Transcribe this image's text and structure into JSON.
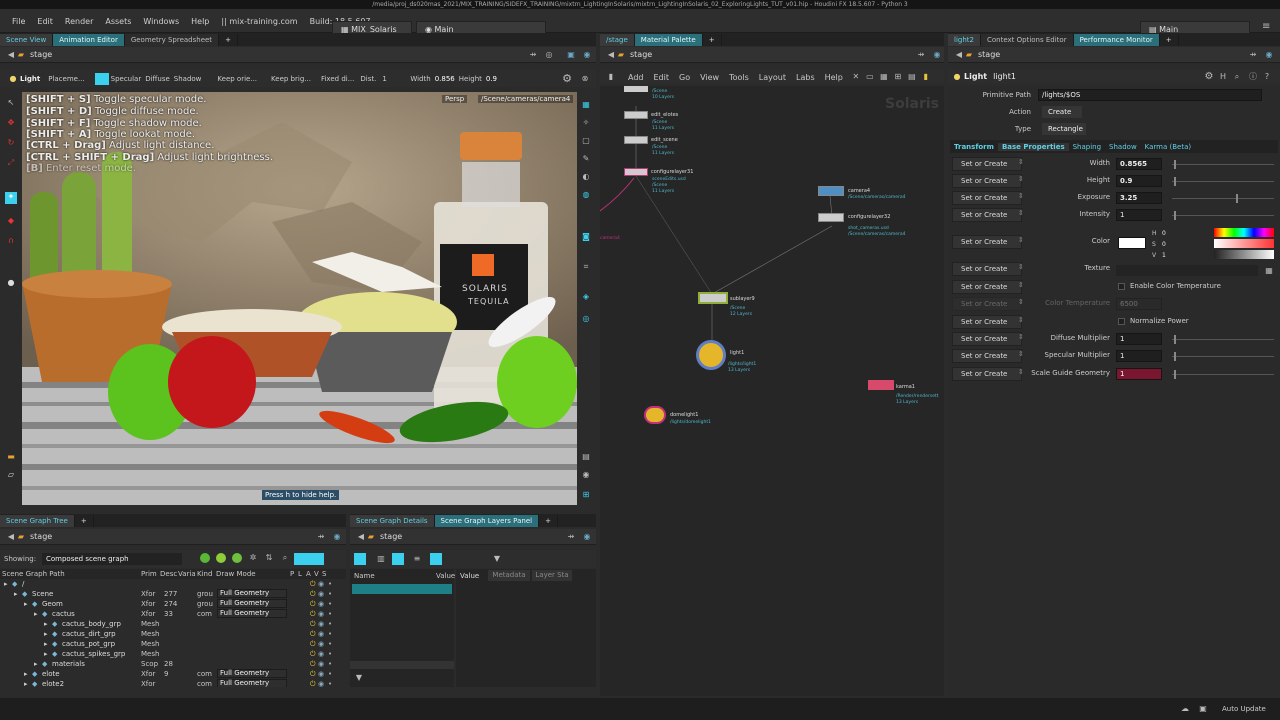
{
  "window": {
    "title": "/media/proj_ds020mas_2021/MIX_TRAINING/SIDEFX_TRAINING/mixtrn_LightingInSolaris/mixtrn_LightingInSolaris_02_ExploringLights_TUT_v01.hip - Houdini FX 18.5.607 - Python 3"
  },
  "menubar": {
    "items": [
      "File",
      "Edit",
      "Render",
      "Assets",
      "Windows",
      "Help"
    ],
    "site": "|| mix-training.com",
    "build": "Build: 18.5.607",
    "desktop1": "MIX_Solaris",
    "desktop2": "Main",
    "desktop3": "Main"
  },
  "left": {
    "tabs": [
      "Scene View",
      "Animation Editor",
      "Geometry Spreadsheet"
    ],
    "path": "stage",
    "toolbar": {
      "light": "Light",
      "placement": "Placeme...",
      "specular": "Specular",
      "diffuse": "Diffuse",
      "shadow": "Shadow",
      "keep_orient": "Keep orie...",
      "keep_bright": "Keep brig...",
      "fixed_dist": "Fixed di...",
      "dist_label": "Dist.",
      "dist_value": "1",
      "width_label": "Width",
      "width_value": "0.856",
      "height_label": "Height",
      "height_value": "0.9"
    },
    "viewport": {
      "persp": "Persp",
      "camera": "/Scene/cameras/camera4",
      "hint": "Press h to hide help.",
      "hud": [
        {
          "key": "[SHIFT + S]",
          "text": " Toggle specular mode."
        },
        {
          "key": "[SHIFT + D]",
          "text": " Toggle diffuse mode."
        },
        {
          "key": "[SHIFT + F]",
          "text": " Toggle shadow mode."
        },
        {
          "key": "[SHIFT + A]",
          "text": " Toggle lookat mode."
        },
        {
          "key": "[CTRL + Drag]",
          "text": " Adjust light distance."
        },
        {
          "key": "[CTRL + SHIFT + Drag]",
          "text": " Adjust light brightness."
        },
        {
          "key": "[B]",
          "text": " Enter reset mode."
        }
      ],
      "bottle_text1": "SOLARIS",
      "bottle_text2": "TEQUILA"
    }
  },
  "middle": {
    "tabs": [
      "/stage",
      "Material Palette"
    ],
    "path": "stage",
    "menu": [
      "Add",
      "Edit",
      "Go",
      "View",
      "Tools",
      "Layout",
      "Labs",
      "Help"
    ],
    "watermark": "Solaris",
    "nodes": [
      {
        "name": "",
        "sub": "/Scene\n10 Layers"
      },
      {
        "name": "edit_elotes",
        "sub": "/Scene\n11 Layers"
      },
      {
        "name": "edit_scene",
        "sub": "/Scene\n11 Layers"
      },
      {
        "name": "configurelayer31",
        "sub": "sceneEdits.usd\n/Scene\n11 Layers"
      },
      {
        "name": "camera4",
        "sub": "/Scene/cameras/camera4"
      },
      {
        "name": "configurelayer32",
        "sub": "shot_cameras.usd\n/Scene/cameras/camera4"
      },
      {
        "name": "sublayer9",
        "sub": "/Scene\n12 Layers"
      },
      {
        "name": "light1",
        "sub": "/lights/light1\n13 Layers"
      },
      {
        "name": "karma1",
        "sub": "/Render/rendersett\n13 Layers"
      },
      {
        "name": "domelight1",
        "sub": "/lights/domelight1"
      }
    ],
    "side_label": "camera4"
  },
  "right": {
    "tabs": [
      "light2",
      "Context Options Editor",
      "Performance Monitor"
    ],
    "path": "stage",
    "node_type": "Light",
    "node_name": "light1",
    "primitive_path_label": "Primitive Path",
    "primitive_path": "/lights/$OS",
    "action_label": "Action",
    "action_value": "Create",
    "type_label": "Type",
    "type_value": "Rectangle",
    "subtabs": [
      "Transform",
      "Base Properties",
      "Shaping",
      "Shadow",
      "Karma (Beta)"
    ],
    "params": [
      {
        "btn": "Set or Create",
        "label": "Width",
        "value": "0.8565"
      },
      {
        "btn": "Set or Create",
        "label": "Height",
        "value": "0.9"
      },
      {
        "btn": "Set or Create",
        "label": "Exposure",
        "value": "3.25"
      },
      {
        "btn": "Set or Create",
        "label": "Intensity",
        "value": "1"
      },
      {
        "btn": "Set or Create",
        "label": "Color",
        "value": ""
      },
      {
        "btn": "Set or Create",
        "label": "Texture",
        "value": ""
      },
      {
        "btn": "Set or Create",
        "label": "Enable Color Temperature",
        "value": ""
      },
      {
        "btn": "Set or Create",
        "label": "Color Temperature",
        "value": "6500"
      },
      {
        "btn": "Set or Create",
        "label": "Normalize Power",
        "value": ""
      },
      {
        "btn": "Set or Create",
        "label": "Diffuse Multiplier",
        "value": "1"
      },
      {
        "btn": "Set or Create",
        "label": "Specular Multiplier",
        "value": "1"
      },
      {
        "btn": "Set or Create",
        "label": "Scale Guide Geometry",
        "value": "1"
      }
    ],
    "color_hsv": {
      "h_label": "H",
      "h": "0",
      "s_label": "S",
      "s": "0",
      "v_label": "V",
      "v": "1"
    }
  },
  "scene_graph": {
    "tabs": [
      "Scene Graph Tree"
    ],
    "path": "stage",
    "showing_label": "Showing:",
    "showing_value": "Composed scene graph",
    "headers": [
      "Scene Graph Path",
      "Prim",
      "Desc",
      "Varia",
      "Kind",
      "Draw Mode",
      "P",
      "L",
      "A",
      "V",
      "S"
    ],
    "rows": [
      {
        "indent": 0,
        "name": "/",
        "prim": "",
        "desc": "",
        "kind": "",
        "draw": ""
      },
      {
        "indent": 1,
        "name": "Scene",
        "prim": "Xfor",
        "desc": "277",
        "kind": "grou",
        "draw": "Full Geometry"
      },
      {
        "indent": 2,
        "name": "Geom",
        "prim": "Xfor",
        "desc": "274",
        "kind": "grou",
        "draw": "Full Geometry"
      },
      {
        "indent": 3,
        "name": "cactus",
        "prim": "Xfor",
        "desc": "33",
        "kind": "com",
        "draw": "Full Geometry"
      },
      {
        "indent": 4,
        "name": "cactus_body_grp",
        "prim": "Mesh",
        "desc": "",
        "kind": "",
        "draw": ""
      },
      {
        "indent": 4,
        "name": "cactus_dirt_grp",
        "prim": "Mesh",
        "desc": "",
        "kind": "",
        "draw": ""
      },
      {
        "indent": 4,
        "name": "cactus_pot_grp",
        "prim": "Mesh",
        "desc": "",
        "kind": "",
        "draw": ""
      },
      {
        "indent": 4,
        "name": "cactus_spikes_grp",
        "prim": "Mesh",
        "desc": "",
        "kind": "",
        "draw": ""
      },
      {
        "indent": 3,
        "name": "materials",
        "prim": "Scop",
        "desc": "28",
        "kind": "",
        "draw": ""
      },
      {
        "indent": 2,
        "name": "elote",
        "prim": "Xfor",
        "desc": "9",
        "kind": "com",
        "draw": "Full Geometry"
      },
      {
        "indent": 2,
        "name": "elote2",
        "prim": "Xfor",
        "desc": "",
        "kind": "com",
        "draw": "Full Geometry"
      }
    ]
  },
  "details": {
    "tabs": [
      "Scene Graph Details",
      "Scene Graph Layers Panel"
    ],
    "path": "stage",
    "name_header": "Name",
    "value_header": "Value",
    "value_tab": "Value",
    "metadata_tab": "Metadata",
    "layer_tab": "Layer Sta"
  },
  "status": {
    "auto_update": "Auto Update"
  }
}
